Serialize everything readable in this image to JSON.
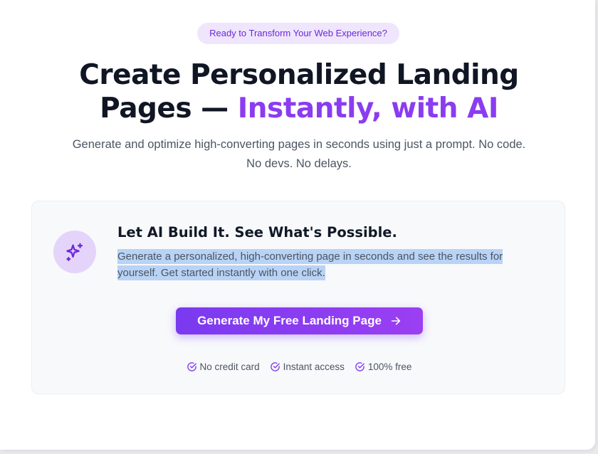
{
  "hero": {
    "badge_text": "Ready to Transform Your Web Experience?",
    "headline_main": "Create Personalized Landing Pages — ",
    "headline_accent": "Instantly, with AI",
    "subheadline": "Generate and optimize high-converting pages in seconds using just a prompt. No code. No devs. No delays."
  },
  "card": {
    "icon": "sparkles-icon",
    "title": "Let AI Build It. See What's Possible.",
    "description": "Generate a personalized, high-converting page in seconds and see the results for yourself. Get started instantly with one click.",
    "cta_label": "Generate My Free Landing Page",
    "features": [
      {
        "icon": "check-circle-icon",
        "label": "No credit card"
      },
      {
        "icon": "check-circle-icon",
        "label": "Instant access"
      },
      {
        "icon": "check-circle-icon",
        "label": "100% free"
      }
    ]
  },
  "colors": {
    "accent": "#8b3cf0",
    "badge_bg": "#efe6fd",
    "button_start": "#7a3af0",
    "button_end": "#9b3ff2",
    "heading": "#101624",
    "body_text": "#4b5563",
    "selection": "#b8d3f5"
  }
}
